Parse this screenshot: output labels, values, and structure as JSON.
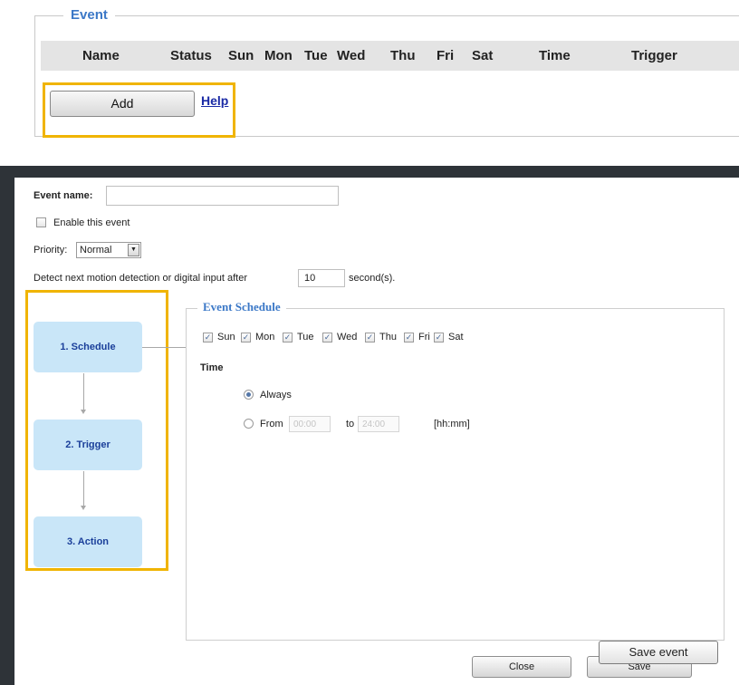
{
  "event_panel": {
    "legend": "Event",
    "columns": [
      "Name",
      "Status",
      "Sun",
      "Mon",
      "Tue",
      "Wed",
      "Thu",
      "Fri",
      "Sat",
      "Time",
      "Trigger"
    ],
    "add_label": "Add",
    "help_label": "Help"
  },
  "dialog": {
    "event_name_label": "Event name:",
    "enable_label": "Enable this event",
    "priority_label": "Priority:",
    "priority_value": "Normal",
    "detect_label": "Detect next motion detection or digital input after",
    "detect_value": "10",
    "detect_unit": "second(s).",
    "steps": [
      "1. Schedule",
      "2. Trigger",
      "3. Action"
    ],
    "schedule": {
      "legend": "Event Schedule",
      "days": [
        "Sun",
        "Mon",
        "Tue",
        "Wed",
        "Thu",
        "Fri",
        "Sat"
      ],
      "days_checked": [
        true,
        true,
        true,
        true,
        true,
        true,
        true
      ],
      "time_label": "Time",
      "always_label": "Always",
      "from_label": "From",
      "from_value": "00:00",
      "to_label": "to",
      "to_value": "24:00",
      "format_hint": "[hh:mm]",
      "selected_time_mode": "Always"
    },
    "close_label": "Close",
    "save_label": "Save",
    "save_event_label": "Save event"
  },
  "colors": {
    "highlight": "#f0b400",
    "legend_blue": "#3b78c7",
    "step_fill": "#c9e6f8",
    "step_text": "#1a3f9a",
    "help_link": "#1a2aa5"
  }
}
